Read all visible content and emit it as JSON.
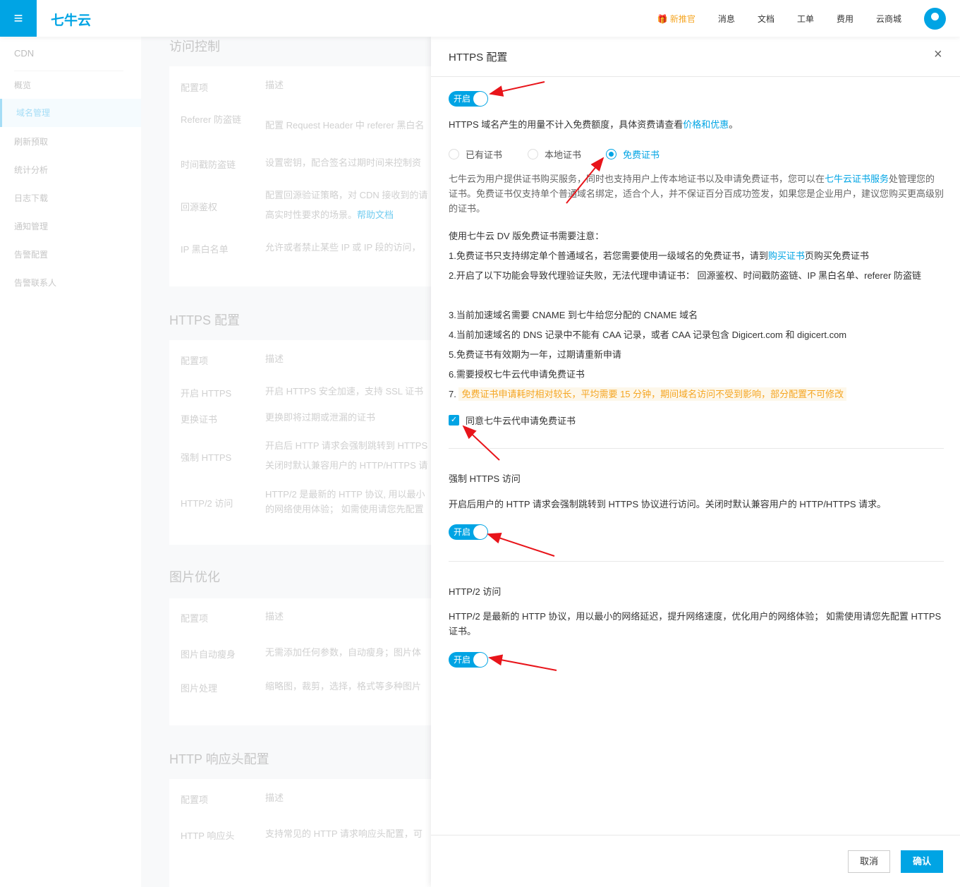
{
  "header": {
    "menu_icon": "≡",
    "logo": "七牛云",
    "nav": [
      "新推官",
      "消息",
      "文档",
      "工单",
      "费用",
      "云商城"
    ]
  },
  "sidebar": {
    "title": "CDN",
    "items": [
      "概览",
      "域名管理",
      "刷新预取",
      "统计分析",
      "日志下载",
      "通知管理",
      "告警配置",
      "告警联系人"
    ]
  },
  "background": {
    "access": {
      "title": "访问控制",
      "head": [
        "配置项",
        "描述"
      ],
      "rows": [
        [
          "Referer 防盗链",
          "配置 Request Header 中 referer 黑白名"
        ],
        [
          "时间戳防盗链",
          "设置密钥，配合签名过期时间来控制资"
        ],
        [
          "回源鉴权",
          "配置回源验证策略，对 CDN 接收到的请"
        ],
        [
          "IP 黑白名单",
          "允许或者禁止某些 IP 或 IP 段的访问，"
        ]
      ],
      "extra": "高实时性要求的场景。",
      "help": "帮助文档"
    },
    "https": {
      "title": "HTTPS 配置",
      "head": [
        "配置项",
        "描述"
      ],
      "rows": [
        [
          "开启 HTTPS",
          "开启 HTTPS 安全加速，支持 SSL 证书"
        ],
        [
          "更换证书",
          "更换即将过期或泄漏的证书"
        ],
        [
          "强制 HTTPS",
          "开启后 HTTP 请求会强制跳转到 HTTPS"
        ],
        [
          "HTTP/2 访问",
          "HTTP/2 是最新的 HTTP 协议, 用以最小"
        ]
      ],
      "extra1": "关闭时默认兼容用户的 HTTP/HTTPS 请",
      "extra2": "的网络使用体验； 如需使用请您先配置"
    },
    "image": {
      "title": "图片优化",
      "head": [
        "配置项",
        "描述"
      ],
      "rows": [
        [
          "图片自动瘦身",
          "无需添加任何参数，自动瘦身；图片体"
        ],
        [
          "图片处理",
          "缩略图，裁剪，选择，格式等多种图片"
        ]
      ]
    },
    "headers": {
      "title": "HTTP 响应头配置",
      "head": [
        "配置项",
        "描述"
      ],
      "rows": [
        [
          "HTTP 响应头",
          "支持常见的 HTTP 请求响应头配置，可"
        ]
      ]
    }
  },
  "drawer": {
    "title": "HTTPS 配置",
    "close": "×",
    "toggle_label": "开启",
    "usage_text": "HTTPS 域名产生的用量不计入免费额度，具体资费请查看",
    "usage_link": "价格和优惠",
    "usage_end": "。",
    "cert_options": [
      "已有证书",
      "本地证书",
      "免费证书"
    ],
    "cert_selected": "免费证书",
    "desc1": "七牛云为用户提供证书购买服务，同时也支持用户上传本地证书以及申请免费证书，您可以在",
    "desc_link": "七牛云证书服务",
    "desc2": "处管理您的证书。免费证书仅支持单个普通域名绑定，适合个人，并不保证百分百成功签发，如果您是企业用户，建议您购买更高级别的证书。",
    "notes_title": "使用七牛云 DV 版免费证书需要注意：",
    "note1a": "1.免费证书只支持绑定单个普通域名，若您需要使用一级域名的免费证书，请到",
    "note1link": "购买证书",
    "note1b": "页购买免费证书",
    "note2": "2.开启了以下功能会导致代理验证失败，无法代理申请证书： 回源鉴权、时间戳防盗链、IP 黑白名单、referer 防盗链",
    "note3": "3.当前加速域名需要 CNAME 到七牛给您分配的 CNAME 域名",
    "note4": "4.当前加速域名的 DNS 记录中不能有 CAA 记录，或者 CAA 记录包含 Digicert.com 和 digicert.com",
    "note5": "5.免费证书有效期为一年，过期请重新申请",
    "note6": "6.需要授权七牛云代申请免费证书",
    "note7a": "7. ",
    "note7": "免费证书申请耗时相对较长，平均需要 15 分钟，期间域名访问不受到影响，部分配置不可修改",
    "agree": "同意七牛云代申请免费证书",
    "agree_checked": true,
    "force_title": "强制 HTTPS 访问",
    "force_desc": "开启后用户的 HTTP 请求会强制跳转到 HTTPS 协议进行访问。关闭时默认兼容用户的 HTTP/HTTPS 请求。",
    "http2_title": "HTTP/2 访问",
    "http2_desc": "HTTP/2 是最新的 HTTP 协议，用以最小的网络延迟，提升网络速度，优化用户的网络体验； 如需使用请您先配置 HTTPS 证书。",
    "cancel": "取消",
    "confirm": "确认"
  }
}
